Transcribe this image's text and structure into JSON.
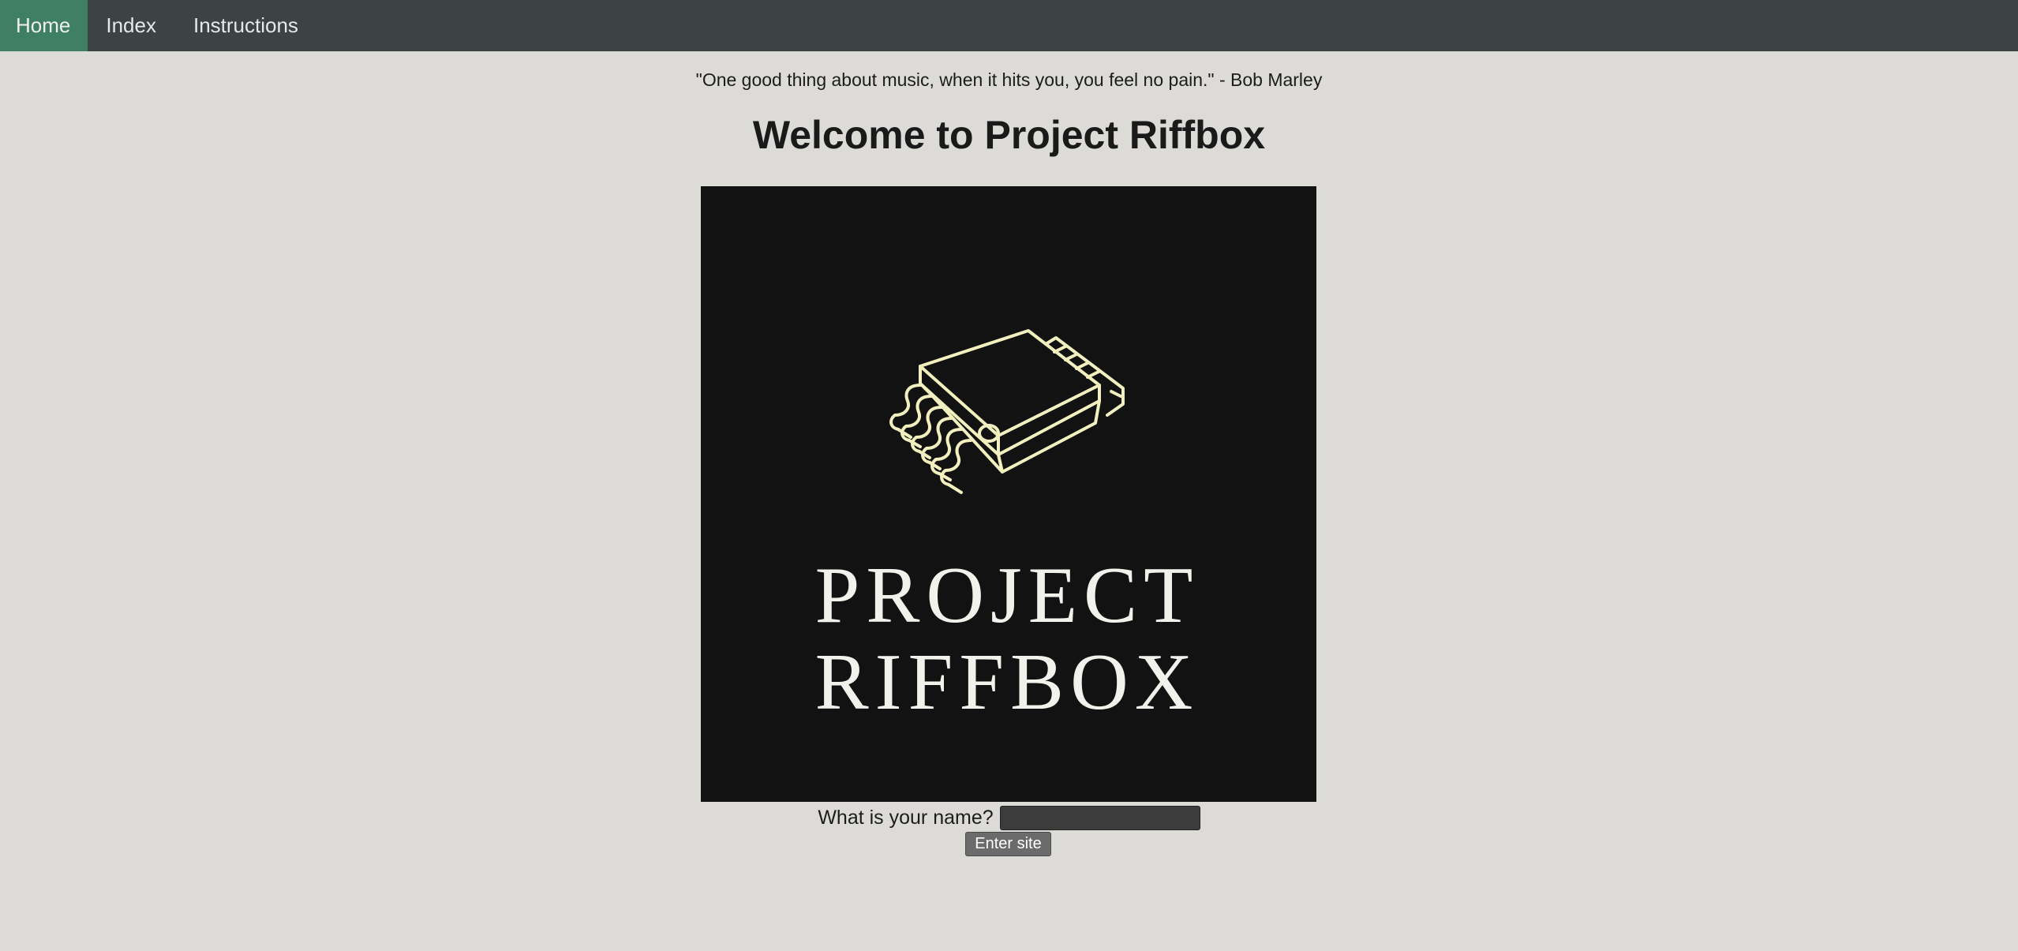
{
  "nav": {
    "items": [
      {
        "label": "Home",
        "active": true
      },
      {
        "label": "Index",
        "active": false
      },
      {
        "label": "Instructions",
        "active": false
      }
    ]
  },
  "quote": "\"One good thing about music, when it hits you, you feel no pain.\" - Bob Marley",
  "title": "Welcome to Project Riffbox",
  "logo": {
    "line1": "PROJECT",
    "line2": "RIFFBOX",
    "icon": "ic-chip-wavy-pins-icon"
  },
  "form": {
    "name_label": "What is your name?",
    "name_value": "",
    "name_placeholder": "",
    "submit_label": "Enter site"
  },
  "colors": {
    "navbar": "#3b4345",
    "nav_active": "#3f7f63",
    "page_background": "#dcdbd8",
    "logo_background": "#121212",
    "logo_chip_stroke": "#f3f0c0",
    "button": "#6b6b6b",
    "input": "#3c3c3c"
  }
}
